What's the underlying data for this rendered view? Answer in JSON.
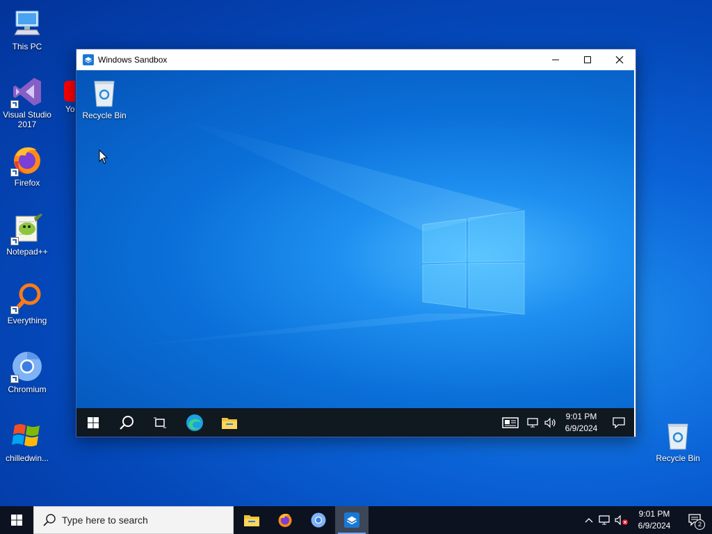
{
  "desktop": {
    "icons": [
      {
        "label": "This PC"
      },
      {
        "label": "Visual Studio 2017"
      },
      {
        "label": "Firefox"
      },
      {
        "label": "Notepad++"
      },
      {
        "label": "Everything"
      },
      {
        "label": "Chromium"
      },
      {
        "label": "chilledwin..."
      },
      {
        "label": "Recycle Bin"
      }
    ],
    "partial_icon_label": "You"
  },
  "sandbox_window": {
    "title": "Windows Sandbox",
    "desktop_icons": [
      {
        "label": "Recycle Bin"
      }
    ],
    "taskbar": {
      "time": "9:01 PM",
      "date": "6/9/2024"
    }
  },
  "taskbar": {
    "search_placeholder": "Type here to search",
    "time": "9:01 PM",
    "date": "6/9/2024",
    "notification_count": "2"
  },
  "colors": {
    "accent": "#0078d7",
    "taskbar": "#0c1220"
  }
}
